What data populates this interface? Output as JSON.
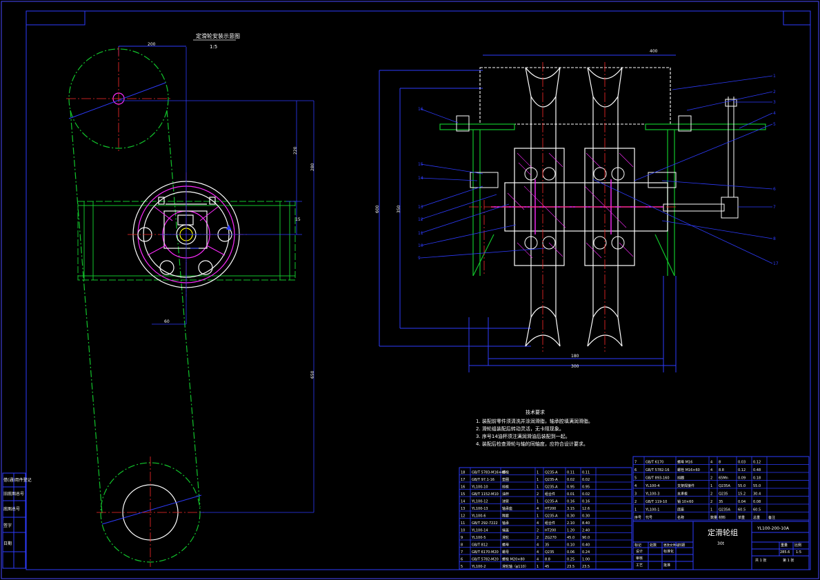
{
  "drawing": {
    "scene_title": "定滑轮安装示意图",
    "scene_scale": "1:5",
    "product_name": "定滑轮组",
    "product_sub": "30t",
    "drawing_number": "YL100-200-10A",
    "sheet_scale": "1:5"
  },
  "tech_requirements": {
    "heading": "技术要求",
    "items": [
      "1. 装配前零件须清洗并涂润滑脂，轴承腔填满润滑脂。",
      "2. 滑轮组装配后转动灵活，无卡阻现象。",
      "3. 序号14油杯须注满润滑油后装配到一起。",
      "4. 装配后检查滑轮与轴的同轴度，应符合设计要求。"
    ]
  },
  "bom_left": [
    {
      "no": "18",
      "code": "GB/T 5783-M16×45",
      "name": "螺栓",
      "qty": "1",
      "material": "Q235-A",
      "unit": "0.11",
      "total": "0.11"
    },
    {
      "no": "17",
      "code": "GB/T 97.1-16",
      "name": "垫圈",
      "qty": "1",
      "material": "Q235-A",
      "unit": "0.02",
      "total": "0.02"
    },
    {
      "no": "16",
      "code": "YL100-10",
      "name": "挡板",
      "qty": "1",
      "material": "Q235-A",
      "unit": "0.95",
      "total": "0.95"
    },
    {
      "no": "15",
      "code": "GB/T 1152-M10",
      "name": "油杯",
      "qty": "2",
      "material": "组合件",
      "unit": "0.01",
      "total": "0.02"
    },
    {
      "no": "14",
      "code": "YL100-12",
      "name": "油管",
      "qty": "1",
      "material": "Q235-A",
      "unit": "0.16",
      "total": "0.16"
    },
    {
      "no": "13",
      "code": "YL100-13",
      "name": "轴承座",
      "qty": "4",
      "material": "HT200",
      "unit": "3.15",
      "total": "12.6"
    },
    {
      "no": "12",
      "code": "YL100-6",
      "name": "隔套",
      "qty": "1",
      "material": "Q235-A",
      "unit": "0.30",
      "total": "0.30"
    },
    {
      "no": "11",
      "code": "GB/T 292-7222",
      "name": "轴承",
      "qty": "4",
      "material": "组合件",
      "unit": "2.10",
      "total": "8.40"
    },
    {
      "no": "10",
      "code": "YL100-14",
      "name": "端盖",
      "qty": "2",
      "material": "HT200",
      "unit": "1.20",
      "total": "2.40"
    },
    {
      "no": "9",
      "code": "YL100-5",
      "name": "滑轮",
      "qty": "2",
      "material": "ZG270",
      "unit": "45.0",
      "total": "90.0"
    },
    {
      "no": "8",
      "code": "GB/T 812",
      "name": "螺母",
      "qty": "4",
      "material": "35",
      "unit": "0.10",
      "total": "0.40"
    },
    {
      "no": "7",
      "code": "GB/T 6170-M20",
      "name": "螺母",
      "qty": "4",
      "material": "Q235",
      "unit": "0.06",
      "total": "0.24"
    },
    {
      "no": "6",
      "code": "GB/T 5782-M20",
      "name": "螺栓 M20×80",
      "qty": "4",
      "material": "8.8",
      "unit": "0.25",
      "total": "1.00"
    },
    {
      "no": "5",
      "code": "YL100-2",
      "name": "滑轮轴（φ110）",
      "qty": "1",
      "material": "45",
      "unit": "23.5",
      "total": "23.5"
    }
  ],
  "bom_right": [
    {
      "no": "7",
      "code": "GB/T 6170",
      "name": "螺母 M16",
      "qty": "4",
      "material": "8",
      "unit": "0.03",
      "total": "0.12"
    },
    {
      "no": "6",
      "code": "GB/T 5782-16",
      "name": "螺栓 M16×60",
      "qty": "4",
      "material": "8.8",
      "unit": "0.12",
      "total": "0.48"
    },
    {
      "no": "5",
      "code": "GB/T 893-160",
      "name": "挡圈",
      "qty": "2",
      "material": "65Mn",
      "unit": "0.09",
      "total": "0.18"
    },
    {
      "no": "4",
      "code": "YL100-4",
      "name": "支架焊接件",
      "qty": "1",
      "material": "Q235A",
      "unit": "55.0",
      "total": "55.0"
    },
    {
      "no": "3",
      "code": "YL100-3",
      "name": "支承板",
      "qty": "2",
      "material": "Q235",
      "unit": "15.2",
      "total": "30.4"
    },
    {
      "no": "2",
      "code": "GB/T 119-10",
      "name": "销 10×60",
      "qty": "2",
      "material": "35",
      "unit": "0.04",
      "total": "0.08"
    },
    {
      "no": "1",
      "code": "YL100-1",
      "name": "底座",
      "qty": "1",
      "material": "Q235A",
      "unit": "60.5",
      "total": "60.5"
    }
  ],
  "bom_header": {
    "no": "序号",
    "code": "代号",
    "name": "名称",
    "qty": "数量",
    "material": "材料",
    "unit": "单重",
    "total": "总重",
    "remark": "备注"
  },
  "title_block": {
    "design": "设计",
    "check": "审核",
    "process": "工艺",
    "approve": "批准",
    "standard": "标准化",
    "weight": "重量",
    "scale": "比例",
    "sheet": "共 1 张",
    "sheet2": "第 1 张",
    "mark": "标记",
    "count": "处数",
    "zone": "分区",
    "change": "更改文件号",
    "sign": "签名",
    "date": "日期",
    "weight_value": "285.6"
  },
  "left_strip": [
    "借(通)用件登记",
    "旧底图总号",
    "底图总号",
    "签字",
    "日期"
  ],
  "colors": {
    "frame": "#2e3cff",
    "green": "#12c62c",
    "red": "#ff2b2b",
    "magenta": "#ff2cff",
    "white": "#ffffff",
    "yellow": "#ffff00",
    "cyan": "#00e5ff"
  }
}
